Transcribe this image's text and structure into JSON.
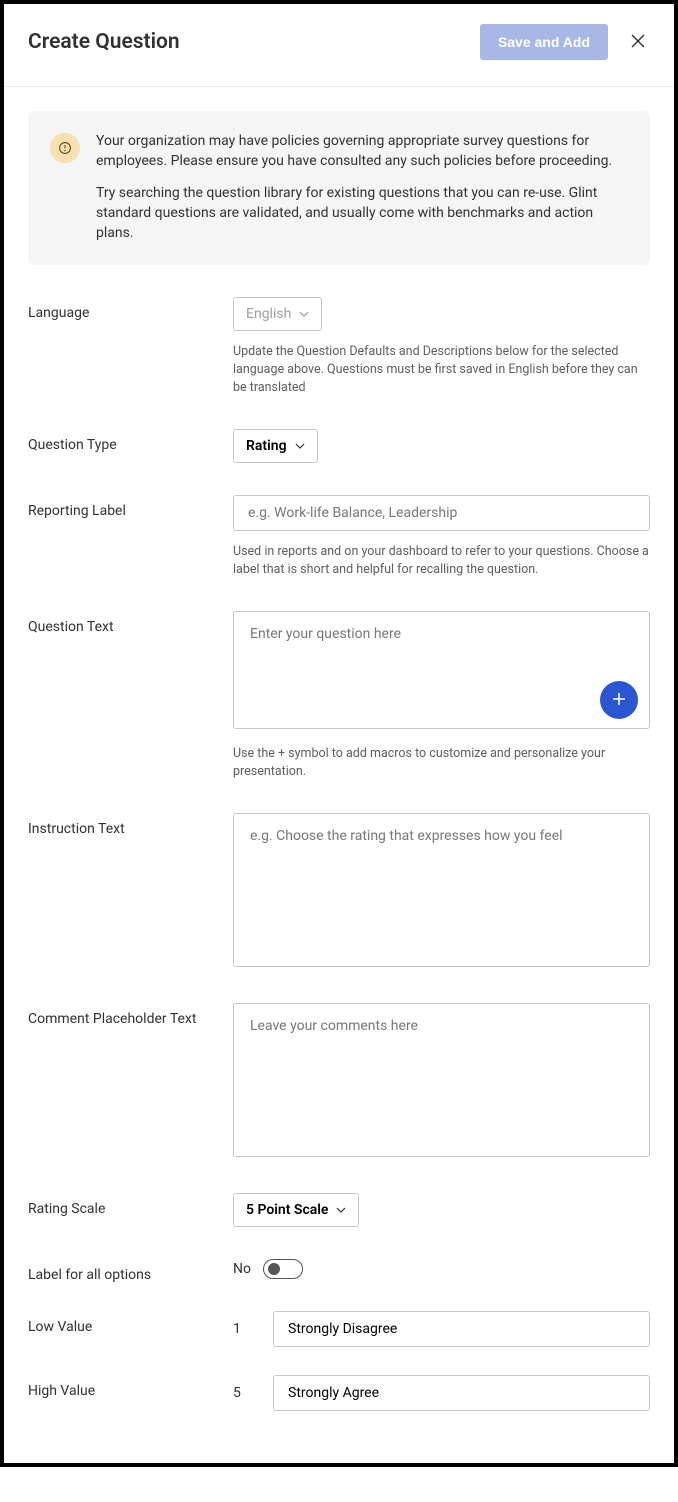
{
  "header": {
    "title": "Create Question",
    "save_label": "Save and Add"
  },
  "notice": {
    "p1": "Your organization may have policies governing appropriate survey questions for employees. Please ensure you have consulted any such policies before proceeding.",
    "p2": "Try searching the question library for existing questions that you can re-use. Glint standard questions are validated, and usually come with benchmarks and action plans."
  },
  "fields": {
    "language": {
      "label": "Language",
      "value": "English",
      "helper": "Update the Question Defaults and Descriptions below for the selected language above. Questions must be first saved in English before they can be translated"
    },
    "question_type": {
      "label": "Question Type",
      "value": "Rating"
    },
    "reporting_label": {
      "label": "Reporting Label",
      "placeholder": "e.g. Work-life Balance, Leadership",
      "helper": "Used in reports and on your dashboard to refer to your questions. Choose a label that is short and helpful for recalling the question."
    },
    "question_text": {
      "label": "Question Text",
      "placeholder": "Enter your question here",
      "helper": "Use the + symbol to add macros to customize and personalize your presentation."
    },
    "instruction_text": {
      "label": "Instruction Text",
      "placeholder": "e.g. Choose the rating that expresses how you feel"
    },
    "comment_placeholder": {
      "label": "Comment Placeholder Text",
      "placeholder": "Leave your comments here"
    },
    "rating_scale": {
      "label": "Rating Scale",
      "value": "5 Point Scale"
    },
    "label_all": {
      "label": "Label for all options",
      "value": "No"
    },
    "low_value": {
      "label": "Low Value",
      "num": "1",
      "value": "Strongly Disagree"
    },
    "high_value": {
      "label": "High Value",
      "num": "5",
      "value": "Strongly Agree"
    }
  }
}
